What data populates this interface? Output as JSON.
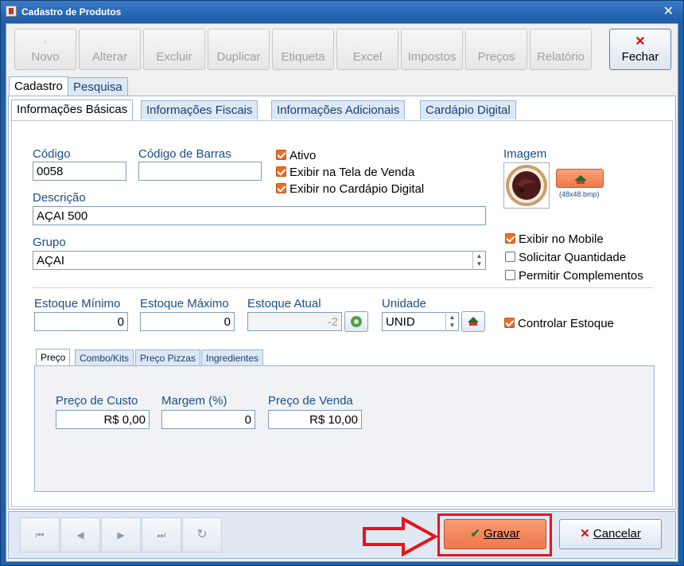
{
  "window": {
    "title": "Cadastro de Produtos"
  },
  "toolbar": {
    "buttons": [
      {
        "label": "Novo",
        "mnemonic": "N",
        "icon": "new-icon",
        "enabled": false
      },
      {
        "label": "Alterar",
        "mnemonic": "A",
        "enabled": false
      },
      {
        "label": "Excluir",
        "mnemonic": "E",
        "enabled": false
      },
      {
        "label": "Duplicar",
        "mnemonic": "D",
        "enabled": false
      },
      {
        "label": "Etiqueta",
        "mnemonic": "E",
        "enabled": false
      },
      {
        "label": "Excel",
        "mnemonic": "x",
        "enabled": false
      },
      {
        "label": "Impostos",
        "mnemonic": "I",
        "enabled": false
      },
      {
        "label": "Preços",
        "mnemonic": "P",
        "enabled": false
      },
      {
        "label": "Relatório",
        "mnemonic": "R",
        "enabled": false
      }
    ],
    "fechar": {
      "label": "Fechar",
      "icon": "close-red-x-icon"
    }
  },
  "main_tabs": [
    "Cadastro",
    "Pesquisa"
  ],
  "sub_tabs": [
    "Informações Básicas",
    "Informações Fiscais",
    "Informações Adicionais",
    "Cardápio Digital"
  ],
  "form": {
    "codigo": {
      "label": "Código",
      "value": "0058"
    },
    "codigo_barras": {
      "label": "Código de Barras",
      "value": ""
    },
    "descricao": {
      "label": "Descrição",
      "value": "AÇAI 500"
    },
    "grupo": {
      "label": "Grupo",
      "value": "AÇAI"
    },
    "checks_top": [
      {
        "label": "Ativo",
        "checked": true
      },
      {
        "label": "Exibir na Tela de Venda",
        "checked": true
      },
      {
        "label": "Exibir no Cardápio Digital",
        "checked": true
      }
    ],
    "imagem": {
      "label": "Imagem",
      "hint": "(48x48.bmp)"
    },
    "checks_right": [
      {
        "label": "Exibir no Mobile",
        "checked": true
      },
      {
        "label": "Solicitar Quantidade",
        "checked": false
      },
      {
        "label": "Permitir Complementos",
        "checked": false
      }
    ],
    "estoque_minimo": {
      "label": "Estoque Mínimo",
      "value": "0"
    },
    "estoque_maximo": {
      "label": "Estoque Máximo",
      "value": "0"
    },
    "estoque_atual": {
      "label": "Estoque Atual",
      "value": "-2"
    },
    "unidade": {
      "label": "Unidade",
      "value": "UNID"
    },
    "controlar_estoque": {
      "label": "Controlar Estoque",
      "checked": true
    }
  },
  "price_tabs": [
    "Preço",
    "Combo/Kits",
    "Preço Pizzas",
    "Ingredientes"
  ],
  "prices": {
    "custo": {
      "label": "Preço de Custo",
      "value": "R$ 0,00"
    },
    "margem": {
      "label": "Margem (%)",
      "value": "0"
    },
    "venda": {
      "label": "Preço de Venda",
      "value": "R$ 10,00"
    }
  },
  "footer": {
    "nav": [
      "first-record-icon",
      "previous-record-icon",
      "next-record-icon",
      "last-record-icon",
      "refresh-icon"
    ],
    "gravar": {
      "label": "Gravar"
    },
    "cancelar": {
      "label": "Cancelar"
    }
  },
  "colors": {
    "accent_orange": "#f5845a",
    "highlight_red": "#e3161c",
    "label_blue": "#1a4e86"
  }
}
